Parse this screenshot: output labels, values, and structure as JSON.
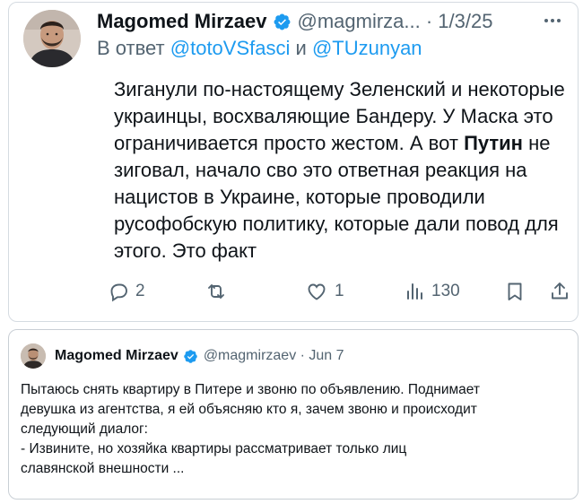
{
  "tweet": {
    "author_name": "Magomed Mirzaev",
    "handle_date": "@magmirza... · 1/3/25",
    "reply_prefix": "В ответ",
    "reply_mention_1": "@totoVSfasci",
    "reply_and": "и",
    "reply_mention_2": "@TUzunyan",
    "text_before_bold": "Зиганули по-настоящему Зеленский и некоторые украинцы, восхваляющие Бандеру. У Маска это ограничивается просто жестом. А вот ",
    "text_bold": "Путин",
    "text_after_bold": " не зиговал, начало сво это ответная реакция на нацистов в Украине, которые проводили русофобскую политику, которые дали повод для этого. Это факт",
    "actions": {
      "reply_count": "2",
      "retweet_count": "",
      "like_count": "1",
      "view_count": "130"
    },
    "icons": [
      "verified-badge-icon",
      "more-icon",
      "reply-icon",
      "retweet-icon",
      "like-icon",
      "views-icon",
      "bookmark-icon",
      "share-icon"
    ]
  },
  "quoted": {
    "author_name": "Magomed Mirzaev",
    "handle_date": "@magmirzaev · Jun 7",
    "line_1": "Пытаюсь снять квартиру в Питере и звоню по объявлению. Поднимает",
    "line_2": "девушка из агентства, я ей объясняю кто я, зачем звоню и происходит",
    "line_3": "следующий диалог:",
    "line_4": "- Извините, но хозяйка квартиры рассматривает только лиц",
    "line_5": "славянской внешности ..."
  },
  "colors": {
    "verified_blue": "#1d9bf0",
    "mention_blue": "#1d9bf0",
    "secondary_gray": "#536471",
    "border": "#d5dbe1"
  }
}
